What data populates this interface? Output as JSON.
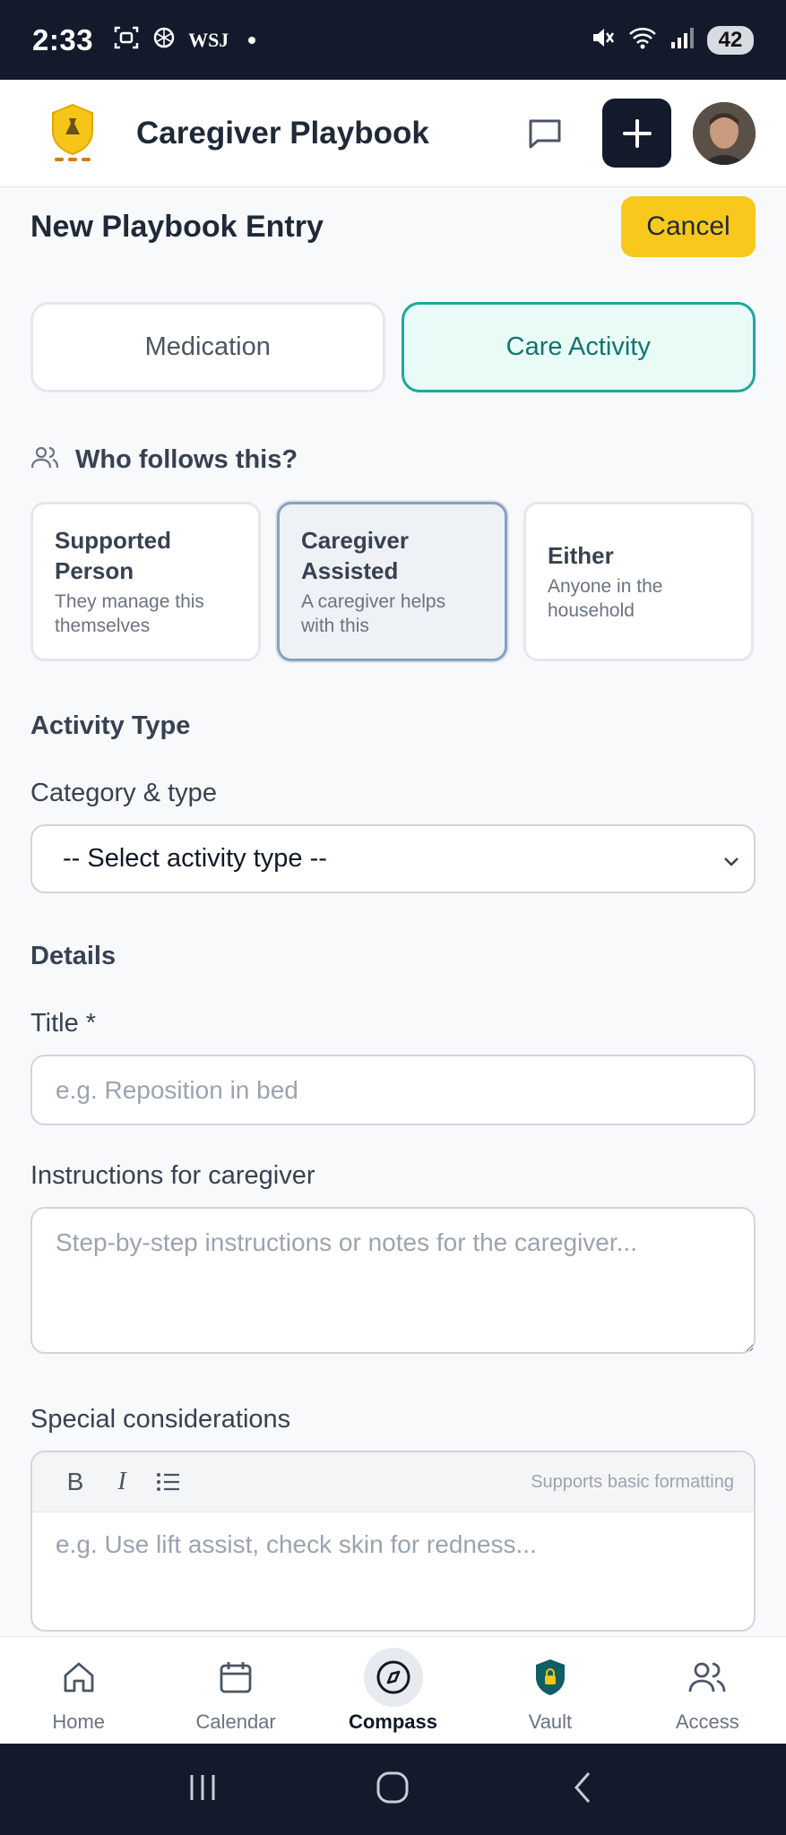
{
  "status_bar": {
    "time": "2:33",
    "wsj": "WSJ",
    "battery": "42",
    "icons": [
      "screenshot-icon",
      "openai-icon",
      "dot-icon",
      "mute-icon",
      "wifi-icon",
      "signal-icon",
      "battery-icon"
    ]
  },
  "header": {
    "app_title": "Caregiver Playbook",
    "icons": [
      "shield-logo-icon",
      "chat-icon",
      "plus-icon",
      "avatar"
    ]
  },
  "page": {
    "title": "New Playbook Entry",
    "cancel_label": "Cancel"
  },
  "type_tabs": [
    {
      "label": "Medication",
      "active": false
    },
    {
      "label": "Care Activity",
      "active": true
    }
  ],
  "follows": {
    "label": "Who follows this?",
    "options": [
      {
        "title": "Supported Person",
        "desc": "They manage this themselves",
        "selected": false
      },
      {
        "title": "Caregiver Assisted",
        "desc": "A caregiver helps with this",
        "selected": true
      },
      {
        "title": "Either",
        "desc": "Anyone in the household",
        "selected": false
      }
    ]
  },
  "activity": {
    "section_label": "Activity Type",
    "field_label": "Category & type",
    "select_value": "-- Select activity type --"
  },
  "details": {
    "section_label": "Details",
    "title_label": "Title *",
    "title_placeholder": "e.g. Reposition in bed",
    "instructions_label": "Instructions for caregiver",
    "instructions_placeholder": "Step-by-step instructions or notes for the caregiver...",
    "special_label": "Special considerations",
    "toolbar": {
      "bold": "B",
      "italic": "I",
      "hint": "Supports basic formatting"
    },
    "special_placeholder": "e.g. Use lift assist, check skin for redness..."
  },
  "bottom_nav": [
    {
      "label": "Home",
      "icon": "home-icon",
      "active": false
    },
    {
      "label": "Calendar",
      "icon": "calendar-icon",
      "active": false
    },
    {
      "label": "Compass",
      "icon": "compass-icon",
      "active": true
    },
    {
      "label": "Vault",
      "icon": "vault-lock-icon",
      "active": false
    },
    {
      "label": "Access",
      "icon": "users-icon",
      "active": false
    }
  ],
  "colors": {
    "status_bar_bg": "#121a2c",
    "accent_teal": "#1ba89c",
    "cancel_yellow": "#f8c91c",
    "add_button_bg": "#121a2c"
  }
}
